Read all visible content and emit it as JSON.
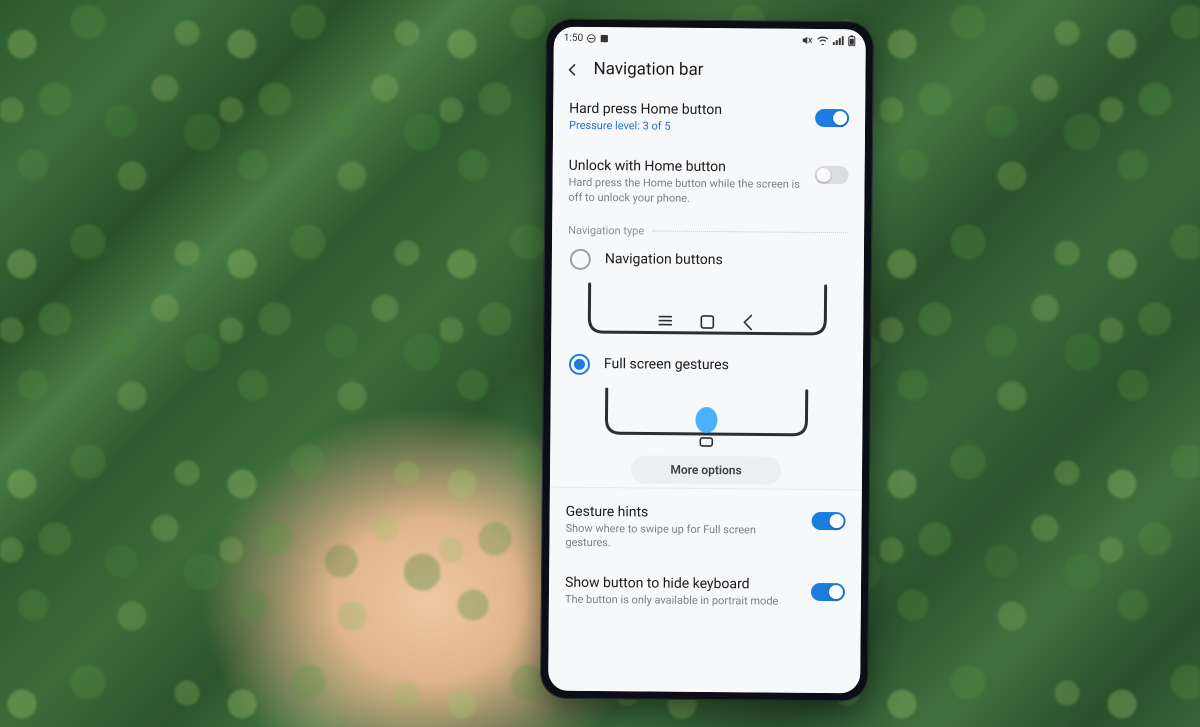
{
  "status": {
    "time": "1:50"
  },
  "header": {
    "title": "Navigation bar"
  },
  "items": {
    "hard_press": {
      "title": "Hard press Home button",
      "sub": "Pressure level: 3 of 5",
      "on": true
    },
    "unlock": {
      "title": "Unlock with Home button",
      "sub": "Hard press the Home button while the screen is off to unlock your phone.",
      "on": false
    },
    "section_label": "Navigation type",
    "nav_buttons_label": "Navigation buttons",
    "full_gestures_label": "Full screen gestures",
    "more_options": "More options",
    "gesture_hints": {
      "title": "Gesture hints",
      "sub": "Show where to swipe up for Full screen gestures.",
      "on": true
    },
    "show_button_kb": {
      "title": "Show button to hide keyboard",
      "sub": "The button is only available in portrait mode",
      "on": true
    }
  }
}
